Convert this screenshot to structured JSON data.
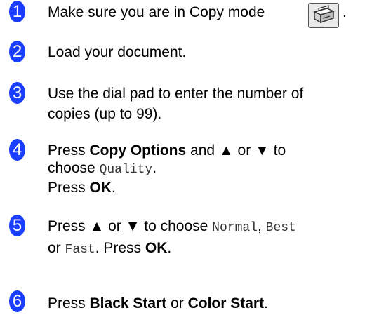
{
  "steps": [
    {
      "number": "1",
      "text": "Make sure you are in Copy mode",
      "trail": "."
    },
    {
      "number": "2",
      "text": "Load your document."
    },
    {
      "number": "3",
      "line1": "Use the dial pad to enter the number of",
      "line2": "copies (up to 99)."
    },
    {
      "number": "4",
      "press": "Press ",
      "copy_options": "Copy Options",
      "and_arrows": " and ▲ or ▼ to",
      "choose": "choose ",
      "quality": "Quality",
      "dot": ".",
      "press2": "Press ",
      "ok": "OK",
      "dot2": "."
    },
    {
      "number": "5",
      "press": "Press ▲ or ▼ to choose ",
      "normal": "Normal",
      "comma": ", ",
      "best": "Best",
      "or": "or ",
      "fast": "Fast",
      "press_ok": ". Press ",
      "ok": "OK",
      "dot": "."
    },
    {
      "number": "6",
      "press": "Press ",
      "black_start": "Black Start",
      "or": " or ",
      "color_start": "Color Start",
      "dot": "."
    }
  ],
  "icons": {
    "copy_mode_icon": "copy-mode-icon",
    "accent_color": "#1a3eff"
  }
}
